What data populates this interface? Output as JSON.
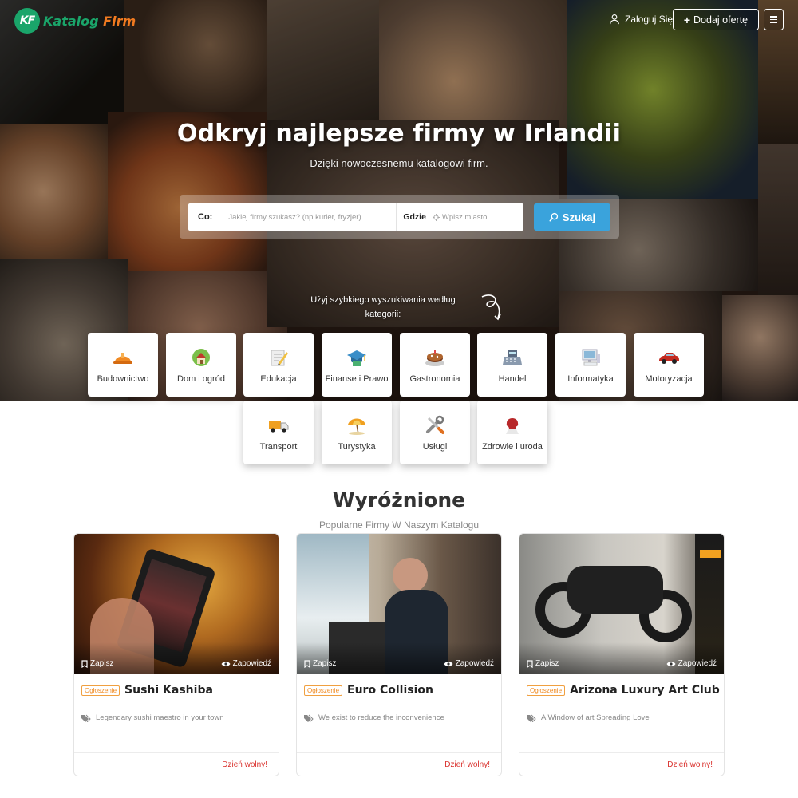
{
  "header": {
    "logo_text_1": "Katalog",
    "logo_text_2": "Firm",
    "logo_mark": "KF",
    "login_label": "Zaloguj Się",
    "add_offer_label": "Dodaj ofertę"
  },
  "hero": {
    "title": "Odkryj najlepsze firmy w Irlandii",
    "subtitle": "Dzięki nowoczesnemu katalogowi firm."
  },
  "search": {
    "what_label": "Co:",
    "what_placeholder": "Jakiej firmy szukasz? (np.kurier, fryzjer)",
    "where_label": "Gdzie",
    "where_placeholder": "Wpisz miasto..",
    "button_label": "Szukaj"
  },
  "quick_search": {
    "hint": "Użyj szybkiego wyszukiwania według kategorii:"
  },
  "categories": [
    {
      "label": "Budownictwo",
      "icon": "helmet-icon"
    },
    {
      "label": "Dom i ogród",
      "icon": "house-icon"
    },
    {
      "label": "Edukacja",
      "icon": "pencil-icon"
    },
    {
      "label": "Finanse i Prawo",
      "icon": "graduation-cap-icon"
    },
    {
      "label": "Gastronomia",
      "icon": "cake-icon"
    },
    {
      "label": "Handel",
      "icon": "cash-register-icon"
    },
    {
      "label": "Informatyka",
      "icon": "computer-icon"
    },
    {
      "label": "Motoryzacja",
      "icon": "car-icon"
    },
    {
      "label": "Transport",
      "icon": "truck-icon"
    },
    {
      "label": "Turystyka",
      "icon": "beach-umbrella-icon"
    },
    {
      "label": "Usługi",
      "icon": "tools-icon"
    },
    {
      "label": "Zdrowie i uroda",
      "icon": "beauty-icon"
    }
  ],
  "featured": {
    "title": "Wyróżnione",
    "subtitle": "Popularne Firmy W Naszym Katalogu",
    "cards": [
      {
        "badge": "Ogłoszenie",
        "name": "Sushi Kashiba",
        "description": "Legendary sushi maestro in your town",
        "save": "Zapisz",
        "preview": "Zapowiedź",
        "status": "Dzień wolny!"
      },
      {
        "badge": "Ogłoszenie",
        "name": "Euro Collision",
        "description": "We exist to reduce the inconvenience",
        "save": "Zapisz",
        "preview": "Zapowiedź",
        "status": "Dzień wolny!"
      },
      {
        "badge": "Ogłoszenie",
        "name": "Arizona Luxury Art Club",
        "description": "A Window of art Spreading Love",
        "save": "Zapisz",
        "preview": "Zapowiedź",
        "status": "Dzień wolny!"
      }
    ]
  },
  "colors": {
    "brand_green": "#1aa56a",
    "brand_orange": "#f07a20",
    "search_button": "#3aa3dc",
    "status_red": "#d9302c"
  }
}
